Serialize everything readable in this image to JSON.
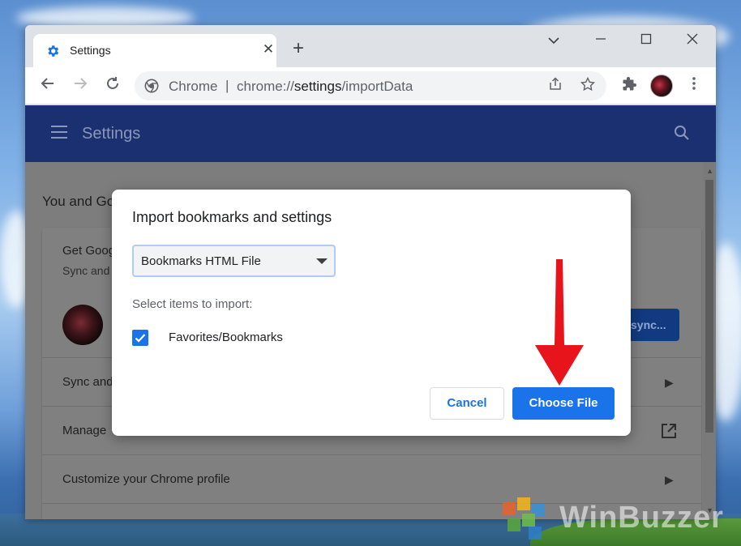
{
  "browser": {
    "tab_title": "Settings",
    "omnibox_label": "Chrome",
    "omnibox_separator": "|",
    "url_prefix": "chrome://",
    "url_path": "settings",
    "url_suffix": "/importData"
  },
  "settings": {
    "header_title": "Settings",
    "section_title": "You and Go",
    "card": {
      "get_google": "Get Goog",
      "sync_and": "Sync and",
      "sync_button": "sync...",
      "row_sync": "Sync and",
      "row_manage": "Manage",
      "row_customize": "Customize your Chrome profile"
    }
  },
  "dialog": {
    "title": "Import bookmarks and settings",
    "source_selected": "Bookmarks HTML File",
    "select_items_label": "Select items to import:",
    "checkbox_label": "Favorites/Bookmarks",
    "checkbox_checked": true,
    "cancel_label": "Cancel",
    "choose_file_label": "Choose File"
  },
  "watermark": {
    "text": "WinBuzzer"
  },
  "colors": {
    "accent": "#1a73e8",
    "header_bg": "#1a3070",
    "arrow": "#e8141b"
  }
}
